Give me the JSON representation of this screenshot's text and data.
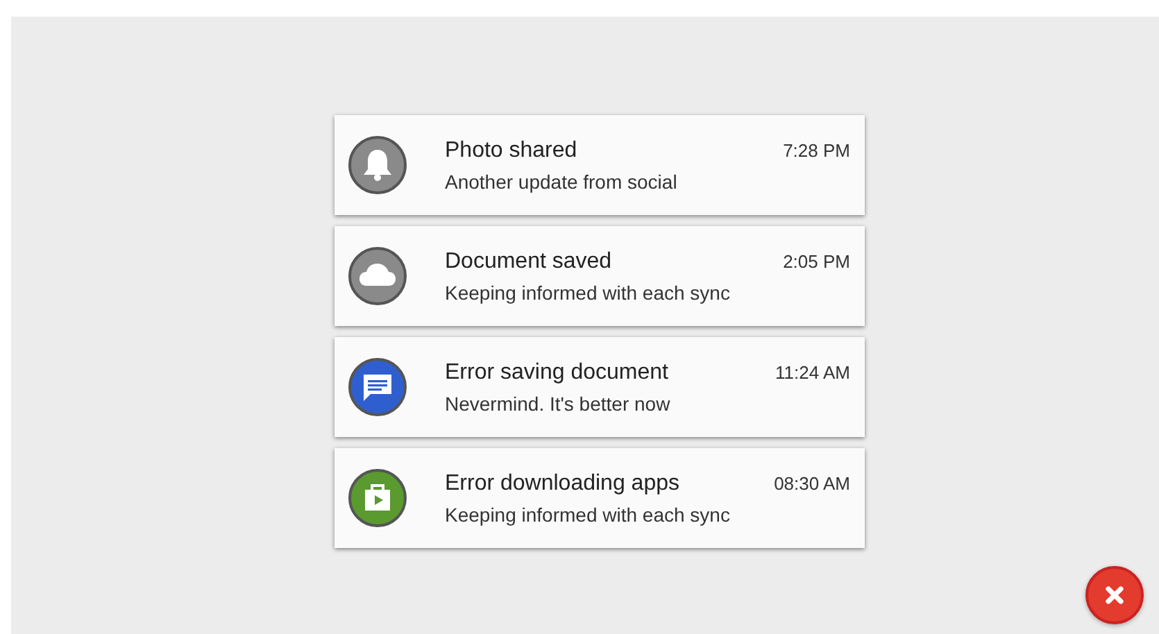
{
  "notifications": [
    {
      "kind": "bell",
      "color": "#8a8a8a",
      "title": "Photo shared",
      "text": "Another update from social",
      "time": "7:28 PM"
    },
    {
      "kind": "cloud",
      "color": "#8a8a8a",
      "title": "Document saved",
      "text": "Keeping informed with each sync",
      "time": "2:05 PM"
    },
    {
      "kind": "message",
      "color": "#2f5fcf",
      "title": "Error saving document",
      "text": "Nevermind. It's better now",
      "time": "11:24 AM"
    },
    {
      "kind": "store",
      "color": "#5a9a2e",
      "title": "Error downloading apps",
      "text": "Keeping informed with each sync",
      "time": "08:30 AM"
    }
  ]
}
